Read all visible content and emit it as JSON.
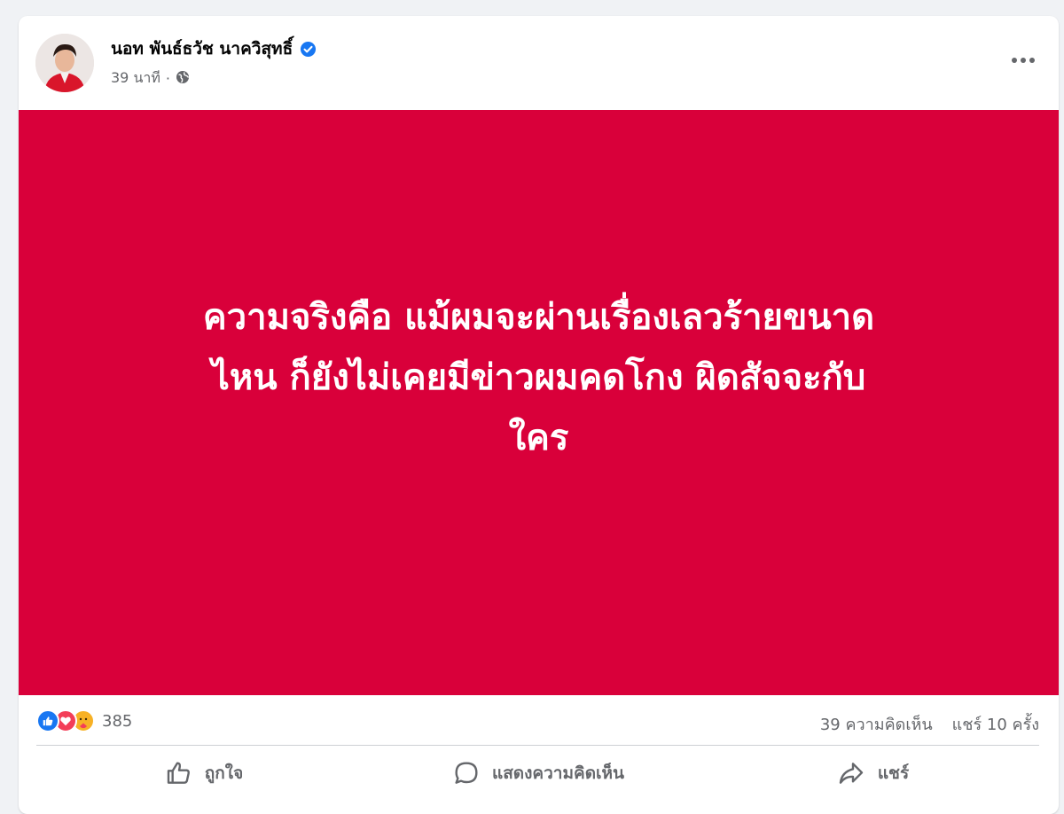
{
  "post": {
    "author": "นอท พันธ์ธวัช นาควิสุทธิ์",
    "time": "39 นาที",
    "separator": "·",
    "text_lines": [
      "ความจริงคือ แม้ผมจะผ่านเรื่องเลวร้ายขนาด",
      "ไหน ก็ยังไม่เคยมีข่าวผมคดโกง ผิดสัจจะกับ",
      "ใคร"
    ],
    "image_bg": "#d9003a"
  },
  "stats": {
    "reaction_icons": [
      "like-icon",
      "love-icon",
      "care-icon"
    ],
    "reaction_count": "385",
    "comments": "39 ความคิดเห็น",
    "shares": "แชร์ 10 ครั้ง"
  },
  "actions": {
    "like": "ถูกใจ",
    "comment": "แสดงความคิดเห็น",
    "share": "แชร์"
  },
  "colors": {
    "like_blue": "#1877f2",
    "love_red": "#f33e58",
    "care_yellow": "#f7b125",
    "verified_blue": "#1877f2"
  }
}
